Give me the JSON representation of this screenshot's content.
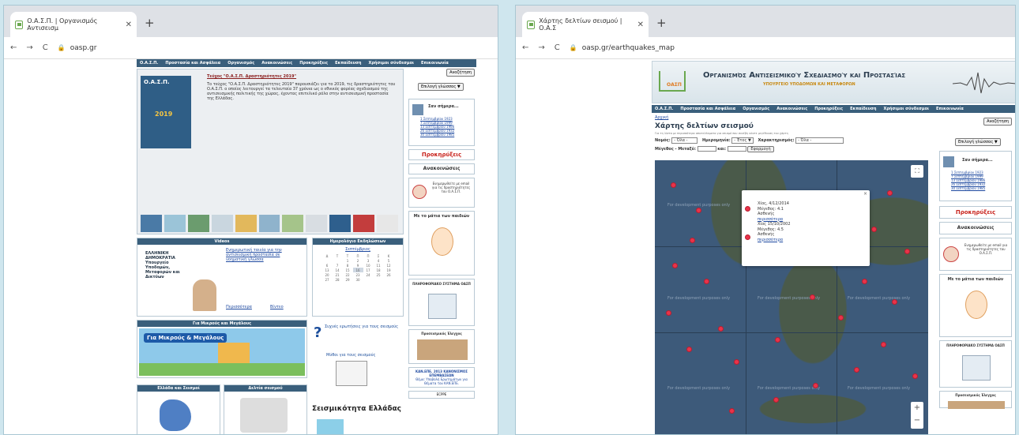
{
  "left": {
    "tab_title": "Ο.Α.Σ.Π. | Οργανισμός Αντισεισμ",
    "url": "oasp.gr",
    "nav": [
      "Ο.Α.Σ.Π.",
      "Προστασία και Ασφάλεια",
      "Οργανισμός",
      "Ανακοινώσεις",
      "Προκηρύξεις",
      "Εκπαίδευση",
      "Χρήσιμοι σύνδεσμοι",
      "Επικοινωνία"
    ],
    "search_btn": "Αναζήτηση",
    "lang_select": "Επιλογή γλώσσας ▼",
    "featured_title": "Τεύχος \"Ο.Α.Σ.Π. Δραστηριότητες 2019\"",
    "featured_text": "Το τεύχος \"Ο.Α.Σ.Π. Δραστηριότητες 2019\" παρουσιάζει για το 2019, τις δραστηριότητες του Ο.Α.Σ.Π. ο οποίος λειτουργεί τα τελευταία 37 χρόνια ως ο εθνικός φορέας σχεδιασμού της αντισεισμικής πολιτικής της χώρας, έχοντας επιτελικό ρόλο στην αντισεισμική προστασία της Ελλάδας.",
    "cover_brand": "Ο.Α.Σ.Π.",
    "cover_year": "2019",
    "today_title": "Σαν σήμερα...",
    "today_items": [
      "1 Σεπτεμβρίου 1923",
      "7 Σεπτεμβρίου 1999",
      "13 Σεπτεμβρίου 1986",
      "26 Σεπτεμβρίου 1932",
      "30 Σεπτεμβρίου 1985"
    ],
    "announce": "Προκηρύξεις",
    "notices": "Ανακοινώσεις",
    "subscribe": "Ενημερωθείτε με email για τις δραστηριότητες του Ο.Α.Σ.Π.",
    "kids": "Με το μάτια των παιδιών",
    "info_system": "ΠΛΗΡΟΦΟΡΙΑΚΟ ΣΥΣΤΗΜΑ ΟΑΣΠ",
    "checks": "Προσεισμικός Έλεγχος",
    "kanepe_title": "ΚΑΝ.ΕΠΕ. 2013 ΚΑΝΟΝΙΣΜΟΣ ΕΠΕΜΒΑΣΕΩΝ",
    "kanepe_text": "Θέμα: Υποβολή Ερωτημάτων για Θέματα του ΚΑΝ.ΕΠΕ.",
    "ecppe": "ECPPE",
    "video_hd": "Videos",
    "video_text": "Ενημερωτική ταινία για την αντισεισμική προστασία σε νοηματική γλώσσα",
    "ministry": "ΕΛΛΗΝΙΚΗ ΔΗΜΟΚΡΑΤΙΑ Υπουργείο Υποδομών, Μεταφορών και Δικτύων",
    "video_links": [
      "Περισσότερα",
      "Βίντεο"
    ],
    "cal_hd": "Ημερολόγιο Εκδηλώσεων",
    "cal_month": "Σεπτέμβριος",
    "cal_days": [
      "Δ",
      "Τ",
      "Τ",
      "Π",
      "Π",
      "Σ",
      "Κ"
    ],
    "cal_rows": [
      [
        "",
        "",
        "1",
        "2",
        "3",
        "4",
        "5"
      ],
      [
        "6",
        "7",
        "8",
        "9",
        "10",
        "11",
        "12"
      ],
      [
        "13",
        "14",
        "15",
        "16",
        "17",
        "18",
        "19"
      ],
      [
        "20",
        "21",
        "22",
        "23",
        "24",
        "25",
        "26"
      ],
      [
        "27",
        "28",
        "29",
        "30",
        "",
        "",
        ""
      ]
    ],
    "kids_hd": "Για Μικρούς και Μεγάλους",
    "kids_banner": "Για Μικρούς & Μεγάλους",
    "faq": "Συχνές ερωτήσεις για τους σεισμούς",
    "myths": "Μύθοι για τους σεισμούς",
    "greece_hd": "Ελλάδα και Σεισμοί",
    "strong_hd": "Δελτία σεισμού",
    "seismicity": "Σεισμικότητα Ελλάδας"
  },
  "right": {
    "tab_title": "Χάρτης δελτίων σεισμού | Ο.Α.Σ",
    "url": "oasp.gr/earthquakes_map",
    "org_name": "Οργανισμός Αντισεισμικού Σχεδιασμού και Προστασίας",
    "org_sub": "ΥΠΟΥΡΓΕΙΟ ΥΠΟΔΟΜΩΝ ΚΑΙ ΜΕΤΑΦΟΡΩΝ",
    "logo": "ΟΑΣΠ",
    "nav": [
      "Ο.Α.Σ.Π.",
      "Προστασία και Ασφάλεια",
      "Οργανισμός",
      "Ανακοινώσεις",
      "Προκηρύξεις",
      "Εκπαίδευση",
      "Χρήσιμοι σύνδεσμοι",
      "Επικοινωνία"
    ],
    "breadcrumb": "Αρχική",
    "page_title": "Χάρτης δελτίων σεισμού",
    "hint": "Για τη λίστα με περισσότερα αποτελέσματα για σεισμό που συνέβη κάντε μεγέθυνση του χάρτη",
    "f_nomos": "Νομός:",
    "f_nomos_val": "- Όλα -",
    "f_date": "Ημερομηνία:",
    "f_date_val": "- Έτος ▼",
    "f_type": "Χαρακτηρισμός:",
    "f_type_val": "- Όλα -",
    "f_mag": "Μέγεθος - Μεταξύ:",
    "f_and": "και:",
    "apply": "Εφαρμογή",
    "popup": [
      "Χίος, 4/12/2014",
      "Μέγεθος: 4.1",
      "Ασθενής",
      "περισσότερα",
      "Χίος 15/10/2002",
      "Μέγεθος: 4.5",
      "Ασθενής",
      "περισσότερα"
    ],
    "dev_watermark": "For development purposes only",
    "zoom_in": "+",
    "zoom_out": "−",
    "search_btn": "Αναζήτηση",
    "lang_select": "Επιλογή γλώσσας ▼",
    "today_title": "Σαν σήμερα...",
    "today_items": [
      "1 Σεπτεμβρίου 1923",
      "7 Σεπτεμβρίου 1999",
      "13 Σεπτεμβρίου 1986",
      "26 Σεπτεμβρίου 1932",
      "30 Σεπτεμβρίου 1985"
    ],
    "announce": "Προκηρύξεις",
    "notices": "Ανακοινώσεις",
    "subscribe": "Ενημερωθείτε με email για τις δραστηριότητες του Ο.Α.Σ.Π.",
    "kids": "Με το μάτια των παιδιών",
    "info_system": "ΠΛΗΡΟΦΟΡΙΑΚΟ ΣΥΣΤΗΜΑ ΟΑΣΠ",
    "checks": "Προσεισμικός Έλεγχος"
  }
}
